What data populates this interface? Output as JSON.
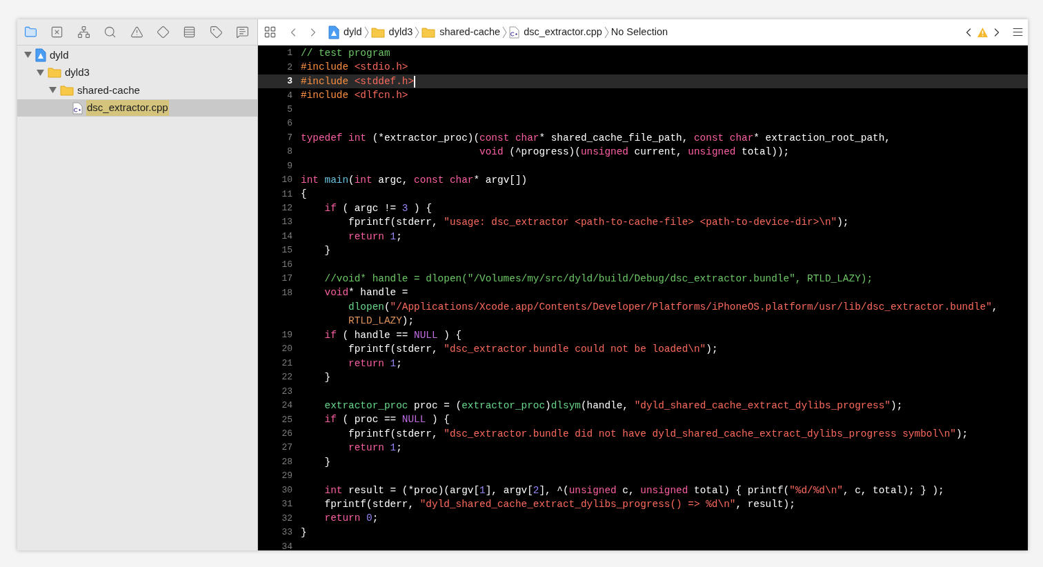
{
  "navigator_tabs": [
    {
      "selected": true
    },
    {
      "selected": false
    },
    {
      "selected": false
    },
    {
      "selected": false
    },
    {
      "selected": false
    },
    {
      "selected": false
    },
    {
      "selected": false
    },
    {
      "selected": false
    },
    {
      "selected": false
    }
  ],
  "tree": [
    {
      "kind": "project",
      "label": "dyld",
      "expanded": true,
      "selected": false,
      "children": [
        {
          "kind": "folder",
          "label": "dyld3",
          "expanded": true,
          "selected": false,
          "children": [
            {
              "kind": "folder",
              "label": "shared-cache",
              "expanded": true,
              "selected": false,
              "children": [
                {
                  "kind": "cpp",
                  "label": "dsc_extractor.cpp",
                  "selected": true,
                  "match": true
                }
              ]
            }
          ]
        }
      ]
    }
  ],
  "jump_bar": {
    "path": [
      {
        "kind": "project",
        "label": "dyld"
      },
      {
        "kind": "folder",
        "label": "dyld3"
      },
      {
        "kind": "folder",
        "label": "shared-cache"
      },
      {
        "kind": "cpp",
        "label": "dsc_extractor.cpp"
      },
      {
        "kind": "none",
        "label": "No Selection"
      }
    ]
  },
  "code": [
    {
      "number": "1",
      "current": false,
      "tokens": [
        {
          "kind": "comment",
          "text": "// test program"
        }
      ]
    },
    {
      "number": "2",
      "current": false,
      "tokens": [
        {
          "kind": "preproc",
          "text": "#include "
        },
        {
          "kind": "string",
          "text": "<stdio.h>"
        }
      ]
    },
    {
      "number": "3",
      "current": true,
      "tokens": [
        {
          "kind": "preproc",
          "text": "#include "
        },
        {
          "kind": "string",
          "text": "<stddef.h>"
        }
      ]
    },
    {
      "number": "4",
      "current": false,
      "tokens": [
        {
          "kind": "preproc",
          "text": "#include "
        },
        {
          "kind": "string",
          "text": "<dlfcn.h>"
        }
      ]
    },
    {
      "number": "5",
      "current": false
    },
    {
      "number": "6",
      "current": false
    },
    {
      "number": "7",
      "current": false,
      "tokens": [
        {
          "kind": "keyword",
          "text": "typedef int"
        },
        {
          "kind": "plain",
          "text": " (*extractor_proc)("
        },
        {
          "kind": "keyword",
          "text": "const char"
        },
        {
          "kind": "plain",
          "text": "* shared_cache_file_path, "
        },
        {
          "kind": "keyword",
          "text": "const char"
        },
        {
          "kind": "plain",
          "text": "* extraction_root_path,"
        }
      ]
    },
    {
      "number": "8",
      "current": false,
      "tokens": [
        {
          "kind": "keyword",
          "text": "                              void"
        },
        {
          "kind": "plain",
          "text": " (^progress)("
        },
        {
          "kind": "keyword",
          "text": "unsigned"
        },
        {
          "kind": "plain",
          "text": " current, "
        },
        {
          "kind": "keyword",
          "text": "unsigned"
        },
        {
          "kind": "plain",
          "text": " total));"
        }
      ]
    },
    {
      "number": "9",
      "current": false
    },
    {
      "number": "10",
      "current": false,
      "tokens": [
        {
          "kind": "keyword",
          "text": "int "
        },
        {
          "kind": "function",
          "text": "main"
        },
        {
          "kind": "plain",
          "text": "("
        },
        {
          "kind": "keyword",
          "text": "int"
        },
        {
          "kind": "plain",
          "text": " argc, "
        },
        {
          "kind": "keyword",
          "text": "const char"
        },
        {
          "kind": "plain",
          "text": "* argv[])"
        }
      ]
    },
    {
      "number": "11",
      "current": false,
      "tokens": [
        {
          "kind": "plain",
          "text": "{"
        }
      ]
    },
    {
      "number": "12",
      "current": false,
      "tokens": [
        {
          "kind": "keyword",
          "text": "    if"
        },
        {
          "kind": "plain",
          "text": " ( argc != "
        },
        {
          "kind": "number",
          "text": "3"
        },
        {
          "kind": "plain",
          "text": " ) {"
        }
      ]
    },
    {
      "number": "13",
      "current": false,
      "tokens": [
        {
          "kind": "plain",
          "text": "        fprintf(stderr, "
        },
        {
          "kind": "string",
          "text": "\"usage: dsc_extractor <path-to-cache-file> <path-to-device-dir>\\n\""
        },
        {
          "kind": "plain",
          "text": ");"
        }
      ]
    },
    {
      "number": "14",
      "current": false,
      "tokens": [
        {
          "kind": "keyword",
          "text": "        return "
        },
        {
          "kind": "number",
          "text": "1"
        },
        {
          "kind": "plain",
          "text": ";"
        }
      ]
    },
    {
      "number": "15",
      "current": false,
      "tokens": [
        {
          "kind": "plain",
          "text": "    }"
        }
      ]
    },
    {
      "number": "16",
      "current": false
    },
    {
      "number": "17",
      "current": false,
      "tokens": [
        {
          "kind": "comment",
          "text": "    //void* handle = dlopen(\"/Volumes/my/src/dyld/build/Debug/dsc_extractor.bundle\", RTLD_LAZY);"
        }
      ]
    },
    {
      "number": "18",
      "current": false,
      "tokens": [
        {
          "kind": "keyword",
          "text": "    void"
        },
        {
          "kind": "plain",
          "text": "* handle ="
        }
      ]
    },
    {
      "current": false,
      "tokens": [
        {
          "kind": "api",
          "text": "        dlopen"
        },
        {
          "kind": "plain",
          "text": "("
        },
        {
          "kind": "string",
          "text": "\"/Applications/Xcode.app/Contents/Developer/Platforms/iPhoneOS.platform/usr/lib/dsc_extractor.bundle\""
        },
        {
          "kind": "plain",
          "text": ","
        }
      ]
    },
    {
      "current": false,
      "tokens": [
        {
          "kind": "macro",
          "text": "        RTLD_LAZY"
        },
        {
          "kind": "plain",
          "text": ");"
        }
      ]
    },
    {
      "number": "19",
      "current": false,
      "tokens": [
        {
          "kind": "keyword",
          "text": "    if"
        },
        {
          "kind": "plain",
          "text": " ( handle == "
        },
        {
          "kind": "null",
          "text": "NULL"
        },
        {
          "kind": "plain",
          "text": " ) {"
        }
      ]
    },
    {
      "number": "20",
      "current": false,
      "tokens": [
        {
          "kind": "plain",
          "text": "        fprintf(stderr, "
        },
        {
          "kind": "string",
          "text": "\"dsc_extractor.bundle could not be loaded\\n\""
        },
        {
          "kind": "plain",
          "text": ");"
        }
      ]
    },
    {
      "number": "21",
      "current": false,
      "tokens": [
        {
          "kind": "keyword",
          "text": "        return "
        },
        {
          "kind": "number",
          "text": "1"
        },
        {
          "kind": "plain",
          "text": ";"
        }
      ]
    },
    {
      "number": "22",
      "current": false,
      "tokens": [
        {
          "kind": "plain",
          "text": "    }"
        }
      ]
    },
    {
      "number": "23",
      "current": false
    },
    {
      "number": "24",
      "current": false,
      "tokens": [
        {
          "kind": "api",
          "text": "    extractor_proc"
        },
        {
          "kind": "plain",
          "text": " proc = ("
        },
        {
          "kind": "api",
          "text": "extractor_proc"
        },
        {
          "kind": "plain",
          "text": ")"
        },
        {
          "kind": "api",
          "text": "dlsym"
        },
        {
          "kind": "plain",
          "text": "(handle, "
        },
        {
          "kind": "string",
          "text": "\"dyld_shared_cache_extract_dylibs_progress\""
        },
        {
          "kind": "plain",
          "text": ");"
        }
      ]
    },
    {
      "number": "25",
      "current": false,
      "tokens": [
        {
          "kind": "keyword",
          "text": "    if"
        },
        {
          "kind": "plain",
          "text": " ( proc == "
        },
        {
          "kind": "null",
          "text": "NULL"
        },
        {
          "kind": "plain",
          "text": " ) {"
        }
      ]
    },
    {
      "number": "26",
      "current": false,
      "tokens": [
        {
          "kind": "plain",
          "text": "        fprintf(stderr, "
        },
        {
          "kind": "string",
          "text": "\"dsc_extractor.bundle did not have dyld_shared_cache_extract_dylibs_progress symbol\\n\""
        },
        {
          "kind": "plain",
          "text": ");"
        }
      ]
    },
    {
      "number": "27",
      "current": false,
      "tokens": [
        {
          "kind": "keyword",
          "text": "        return "
        },
        {
          "kind": "number",
          "text": "1"
        },
        {
          "kind": "plain",
          "text": ";"
        }
      ]
    },
    {
      "number": "28",
      "current": false,
      "tokens": [
        {
          "kind": "plain",
          "text": "    }"
        }
      ]
    },
    {
      "number": "29",
      "current": false
    },
    {
      "number": "30",
      "current": false,
      "tokens": [
        {
          "kind": "keyword",
          "text": "    int"
        },
        {
          "kind": "plain",
          "text": " result = (*proc)(argv["
        },
        {
          "kind": "number",
          "text": "1"
        },
        {
          "kind": "plain",
          "text": "], argv["
        },
        {
          "kind": "number",
          "text": "2"
        },
        {
          "kind": "plain",
          "text": "], ^("
        },
        {
          "kind": "keyword",
          "text": "unsigned"
        },
        {
          "kind": "plain",
          "text": " c, "
        },
        {
          "kind": "keyword",
          "text": "unsigned"
        },
        {
          "kind": "plain",
          "text": " total) { printf("
        },
        {
          "kind": "string",
          "text": "\"%d/%d\\n\""
        },
        {
          "kind": "plain",
          "text": ", c, total); } );"
        }
      ]
    },
    {
      "number": "31",
      "current": false,
      "tokens": [
        {
          "kind": "plain",
          "text": "    fprintf(stderr, "
        },
        {
          "kind": "string",
          "text": "\"dyld_shared_cache_extract_dylibs_progress() => %d\\n\""
        },
        {
          "kind": "plain",
          "text": ", result);"
        }
      ]
    },
    {
      "number": "32",
      "current": false,
      "tokens": [
        {
          "kind": "keyword",
          "text": "    return "
        },
        {
          "kind": "number",
          "text": "0"
        },
        {
          "kind": "plain",
          "text": ";"
        }
      ]
    },
    {
      "number": "33",
      "current": false,
      "tokens": [
        {
          "kind": "plain",
          "text": "}"
        }
      ]
    },
    {
      "number": "34",
      "current": false
    }
  ]
}
